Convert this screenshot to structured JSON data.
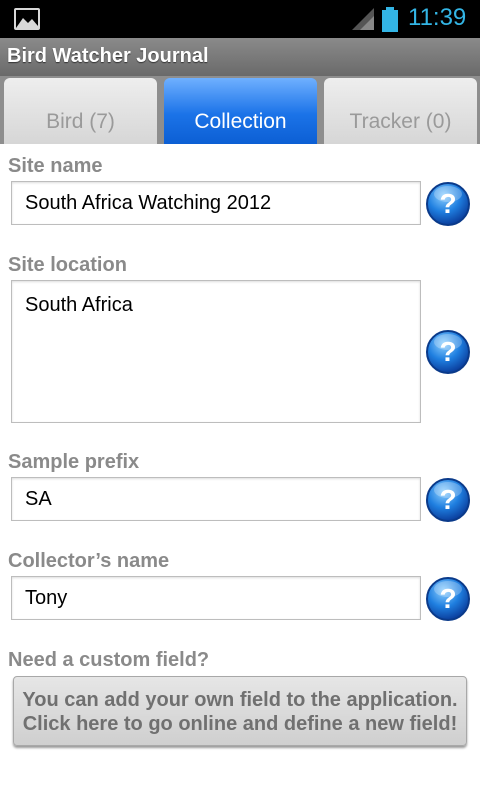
{
  "status_bar": {
    "time": "11:39",
    "left_icon": "gallery-icon",
    "signal_icon": "signal-icon",
    "battery_icon": "battery-icon",
    "accent_color": "#33b5e5"
  },
  "app": {
    "title": "Bird Watcher Journal"
  },
  "tabs": [
    {
      "label": "Bird (7)",
      "active": false
    },
    {
      "label": "Collection",
      "active": true
    },
    {
      "label": "Tracker (0)",
      "active": false
    }
  ],
  "form": {
    "site_name": {
      "label": "Site name",
      "value": "South Africa Watching 2012"
    },
    "site_location": {
      "label": "Site location",
      "value": "South Africa"
    },
    "sample_prefix": {
      "label": "Sample prefix",
      "value": "SA"
    },
    "collector_name": {
      "label": "Collector’s name",
      "value": "Tony"
    },
    "help_icon": "question-mark-icon"
  },
  "custom_field": {
    "label": "Need a custom field?",
    "button_line1": "You can add your own field to the application.",
    "button_line2": "Click here to go online and define a new field!"
  }
}
